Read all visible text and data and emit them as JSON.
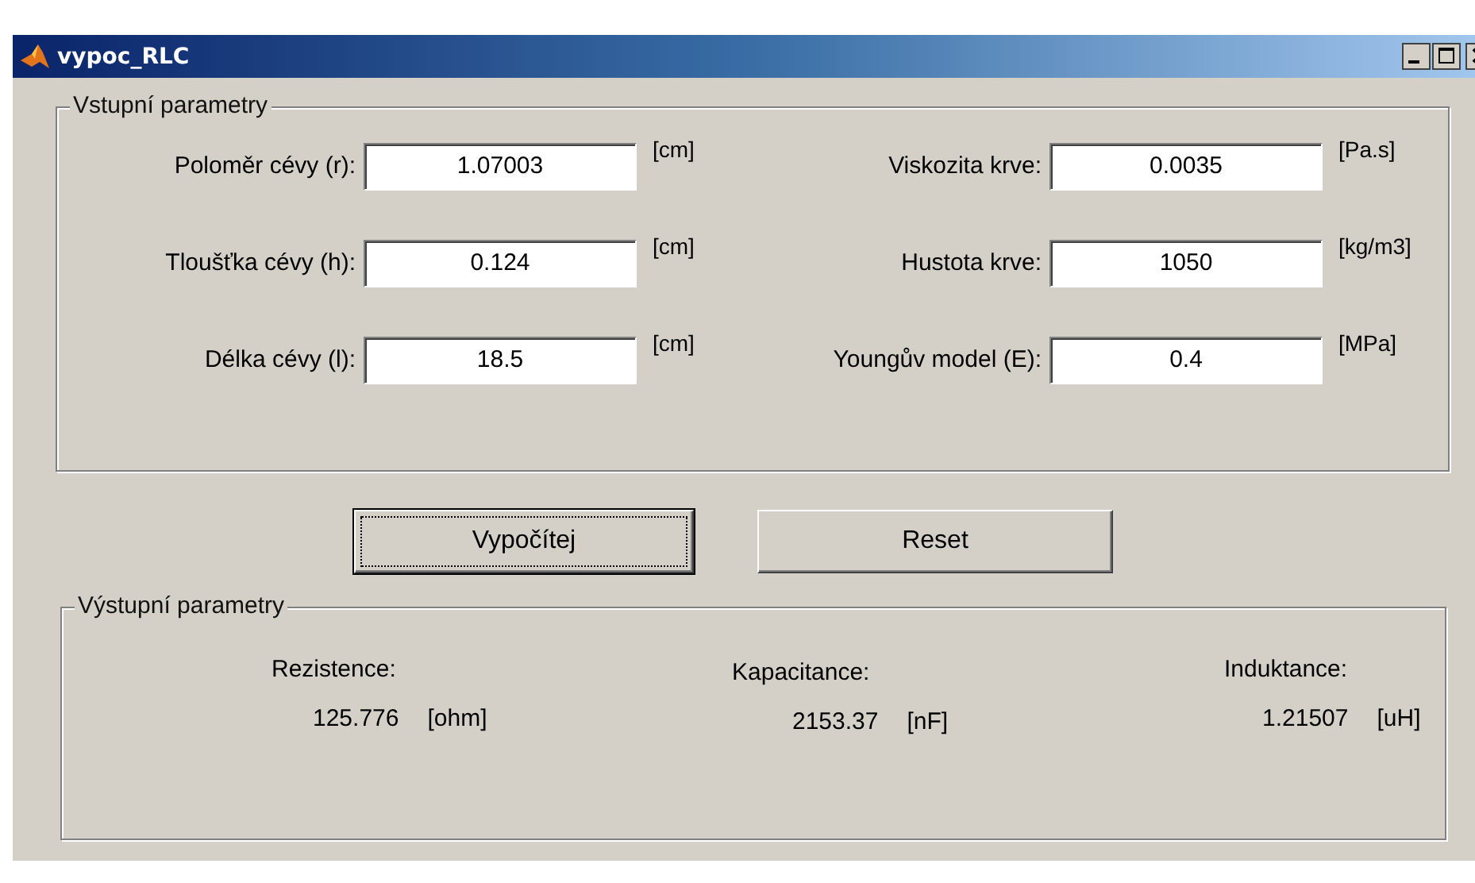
{
  "window": {
    "title": "vypoc_RLC"
  },
  "input_group": {
    "title": "Vstupní parametry",
    "rows": [
      {
        "left": {
          "label": "Poloměr cévy (r):",
          "value": "1.07003",
          "unit": "[cm]"
        },
        "right": {
          "label": "Viskozita krve:",
          "value": "0.0035",
          "unit": "[Pa.s]"
        }
      },
      {
        "left": {
          "label": "Tloušťka cévy (h):",
          "value": "0.124",
          "unit": "[cm]"
        },
        "right": {
          "label": "Hustota krve:",
          "value": "1050",
          "unit": "[kg/m3]"
        }
      },
      {
        "left": {
          "label": "Délka cévy (l):",
          "value": "18.5",
          "unit": "[cm]"
        },
        "right": {
          "label": "Youngův model (E):",
          "value": "0.4",
          "unit": "[MPa]"
        }
      }
    ]
  },
  "buttons": [
    {
      "label": "Vypočítej",
      "focused": true
    },
    {
      "label": "Reset",
      "focused": false
    }
  ],
  "output_group": {
    "title": "Výstupní parametry",
    "results": [
      {
        "label": "Rezistence:",
        "value": "125.776",
        "unit": "[ohm]"
      },
      {
        "label": "Kapacitance:",
        "value": "2153.37",
        "unit": "[nF]"
      },
      {
        "label": "Induktance:",
        "value": "1.21507",
        "unit": "[uH]"
      }
    ]
  }
}
